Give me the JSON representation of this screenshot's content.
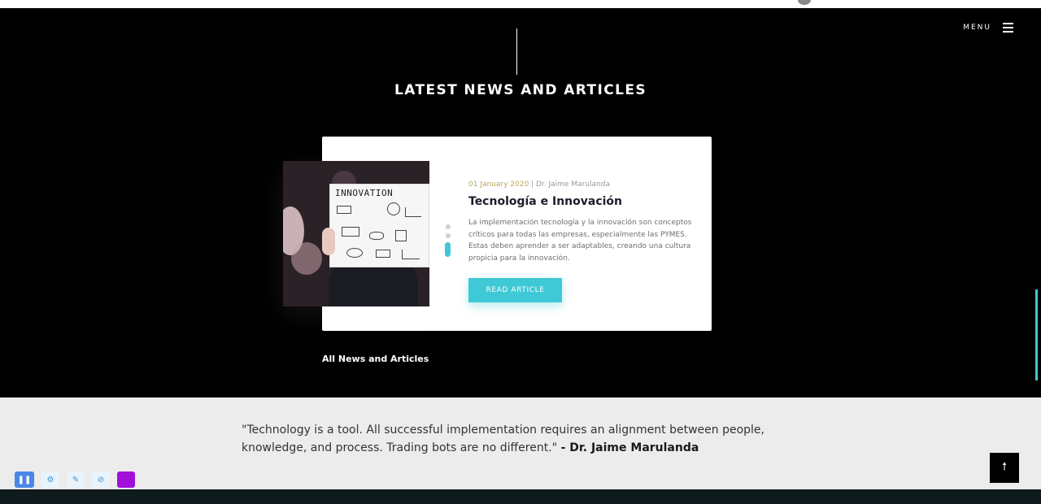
{
  "menu": {
    "label": "MENU"
  },
  "section": {
    "title": "LATEST NEWS AND ARTICLES"
  },
  "article": {
    "date": "01 January 2020",
    "separator": " | ",
    "author": "Dr. Jaime Marulanda",
    "title": "Tecnología e Innovación",
    "excerpt": "La implementación tecnología y la innovación son conceptos críticos para todas las empresas, especialmente las PYMES. Estas deben aprender a ser adaptables, creando una cultura propicia para la innovación.",
    "button": "READ ARTICLE",
    "image_text": "INNOVATION"
  },
  "links": {
    "all_news": "All News and Articles"
  },
  "quote": {
    "text": "\"Technology is a tool. All successful implementation requires an alignment between people, knowledge, and process. Trading bots are no different.\"",
    "author": "- Dr. Jaime Marulanda"
  },
  "slider": {
    "active_index": 3,
    "count": 3
  },
  "icons": {
    "back_to_top": "arrow-up-icon",
    "menu": "hamburger-icon",
    "tools": [
      "pause-icon",
      "settings-icon",
      "pen-icon",
      "link-icon",
      "color-swatch-icon"
    ]
  },
  "colors": {
    "accent": "#3fc8d6",
    "date_color": "#b9a85a",
    "swatch": "#a010d9",
    "pause_button": "#4a86e8"
  }
}
